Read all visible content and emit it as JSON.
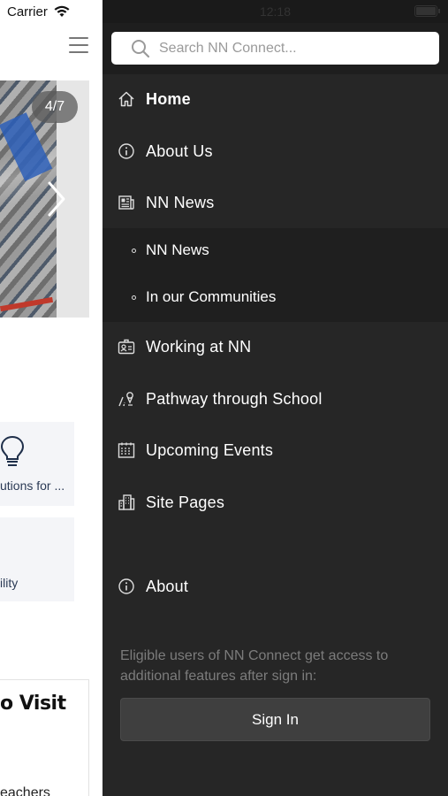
{
  "status_bar": {
    "carrier": "Carrier",
    "time": "12:18"
  },
  "background_page": {
    "carousel_counter": "4/7",
    "card1_text": "utions for ...",
    "card2_text": "ility",
    "visit_title": "o Visit",
    "visit_sub": "eachers"
  },
  "drawer": {
    "search_placeholder": "Search NN Connect...",
    "menu": [
      {
        "label": "Home",
        "icon": "home-icon"
      },
      {
        "label": "About Us",
        "icon": "info-icon"
      },
      {
        "label": "NN News",
        "icon": "newspaper-icon"
      },
      {
        "label": "Working at NN",
        "icon": "id-badge-icon"
      },
      {
        "label": "Pathway through School",
        "icon": "pathway-icon"
      },
      {
        "label": "Upcoming Events",
        "icon": "calendar-icon"
      },
      {
        "label": "Site Pages",
        "icon": "buildings-icon"
      },
      {
        "label": "About",
        "icon": "info-icon"
      }
    ],
    "submenu": [
      {
        "label": "NN News"
      },
      {
        "label": "In our Communities"
      }
    ],
    "signin_note": "Eligible users of NN Connect get access to additional features after sign in:",
    "signin_label": "Sign In"
  },
  "colors": {
    "drawer_bg": "#262626",
    "submenu_bg": "#1f1f1f",
    "button_bg": "#3f3f3f",
    "note_text": "#7c7c7c"
  }
}
